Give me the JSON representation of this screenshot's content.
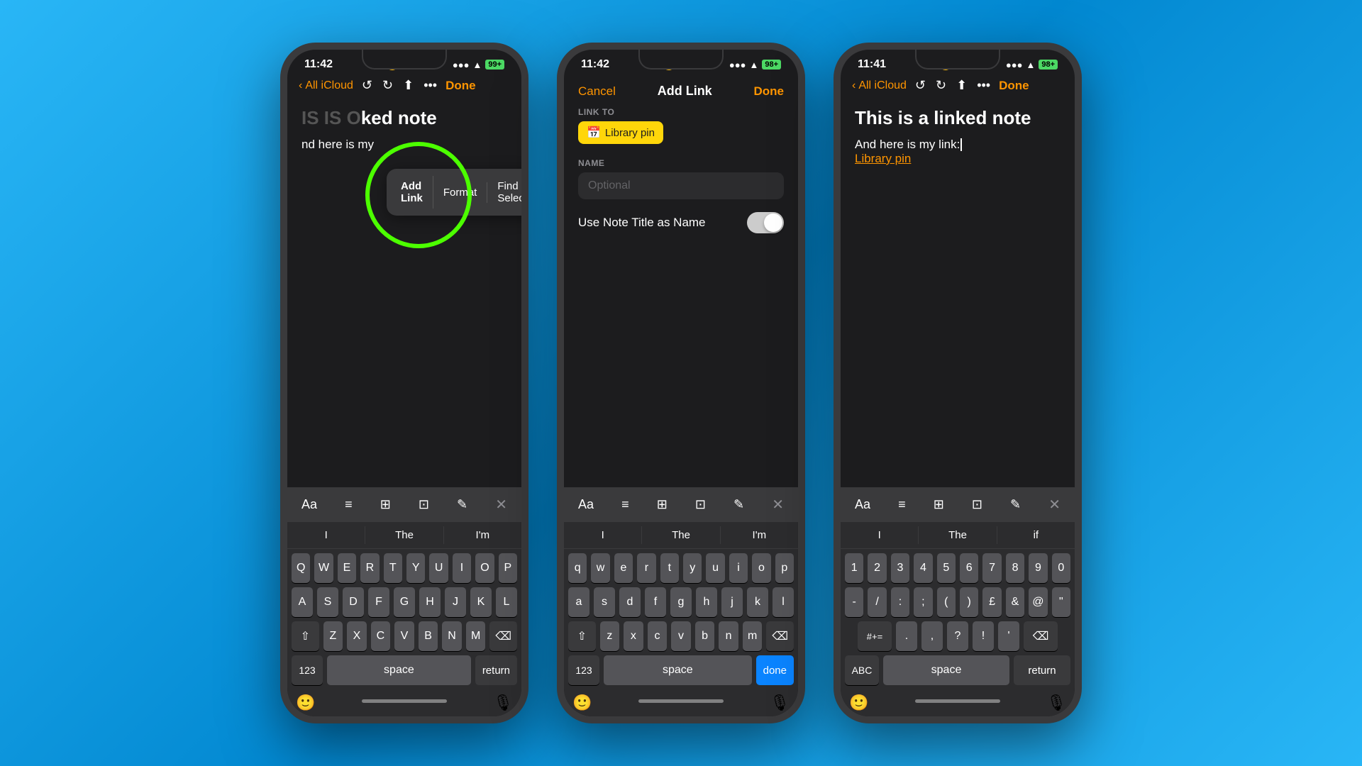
{
  "background": "#29b6f6",
  "phones": [
    {
      "id": "phone1",
      "statusBar": {
        "time": "11:42",
        "moonIcon": "🌙",
        "signalDots": "●●●●",
        "wifiIcon": "WiFi",
        "batteryText": "99+",
        "batteryColor": "#4cd964"
      },
      "navBar": {
        "backLabel": "All iCloud",
        "doneLabel": "Done"
      },
      "note": {
        "titleFragment": "IS IS O",
        "titleSuffix": "ked note",
        "bodyText": "nd here is my"
      },
      "popup": {
        "items": [
          "Add Link",
          "Format",
          "Find Selection"
        ]
      },
      "keyboard": {
        "toolbar": [
          "Aa",
          "≡",
          "⊞",
          "⊡",
          "✎",
          "✕"
        ],
        "suggestions": [
          "I",
          "The",
          "I'm"
        ],
        "rows": [
          [
            "Q",
            "W",
            "E",
            "R",
            "T",
            "Y",
            "U",
            "I",
            "O",
            "P"
          ],
          [
            "A",
            "S",
            "D",
            "F",
            "G",
            "H",
            "J",
            "K",
            "L"
          ],
          [
            "⇧",
            "Z",
            "X",
            "C",
            "V",
            "B",
            "N",
            "M",
            "⌫"
          ],
          [
            "123",
            "space",
            "return"
          ]
        ]
      }
    },
    {
      "id": "phone2",
      "statusBar": {
        "time": "11:42",
        "moonIcon": "🌙",
        "signalDots": "●●●●",
        "wifiIcon": "WiFi",
        "batteryText": "98+",
        "batteryColor": "#4cd964"
      },
      "header": {
        "cancelLabel": "Cancel",
        "title": "Add Link",
        "doneLabel": "Done"
      },
      "linkTo": {
        "sectionLabel": "LINK TO",
        "chipIcon": "🗓",
        "chipText": "Library pin"
      },
      "name": {
        "sectionLabel": "NAME",
        "placeholder": "Optional",
        "toggleLabel": "Use Note Title as Name"
      },
      "keyboard": {
        "toolbar": [
          "Aa",
          "≡",
          "⊞",
          "⊡",
          "✎",
          "✕"
        ],
        "suggestions": [
          "I",
          "The",
          "I'm"
        ],
        "rows": [
          [
            "q",
            "w",
            "e",
            "r",
            "t",
            "y",
            "u",
            "i",
            "o",
            "p"
          ],
          [
            "a",
            "s",
            "d",
            "f",
            "g",
            "h",
            "j",
            "k",
            "l"
          ],
          [
            "⇧",
            "z",
            "x",
            "c",
            "v",
            "b",
            "n",
            "m",
            "⌫"
          ],
          [
            "123",
            "space",
            "done"
          ]
        ]
      }
    },
    {
      "id": "phone3",
      "statusBar": {
        "time": "11:41",
        "moonIcon": "🌙",
        "signalDots": "●●●●",
        "wifiIcon": "WiFi",
        "batteryText": "98+",
        "batteryColor": "#4cd964"
      },
      "navBar": {
        "backLabel": "All iCloud",
        "doneLabel": "Done"
      },
      "note": {
        "title": "This is a linked note",
        "bodyText": "And here is my link:",
        "linkText": "Library pin"
      },
      "keyboard": {
        "toolbar": [
          "Aa",
          "≡",
          "⊞",
          "⊡",
          "✎",
          "✕"
        ],
        "suggestions": [
          "I",
          "The",
          "if"
        ],
        "numRow": [
          "1",
          "2",
          "3",
          "4",
          "5",
          "6",
          "7",
          "8",
          "9",
          "0"
        ],
        "symRow": [
          "-",
          "/",
          ":",
          ";",
          "(",
          ")",
          "£",
          "&",
          "@",
          "\""
        ],
        "bottomRow": [
          "#+=",
          ".",
          ",",
          "?",
          "!",
          "'",
          "⌫"
        ],
        "bottomBar": [
          "ABC",
          "space",
          "return"
        ]
      }
    }
  ]
}
